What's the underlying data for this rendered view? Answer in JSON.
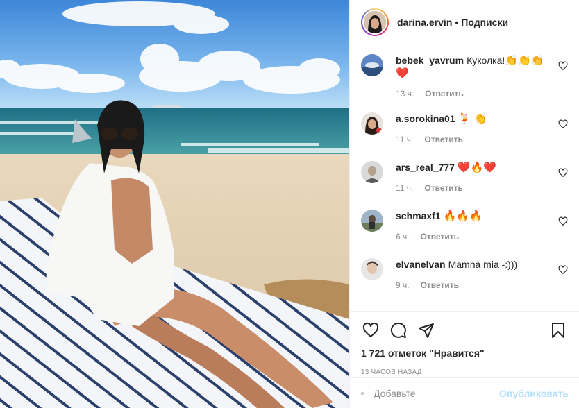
{
  "header": {
    "username": "darina.ervin",
    "separator": "•",
    "follow_label": "Подписки"
  },
  "comments": [
    {
      "user": "bebek_yavrum",
      "text": "Куколка!",
      "emoji": "👏👏👏❤️",
      "time": "13 ч.",
      "reply": "Ответить"
    },
    {
      "user": "a.sorokina01",
      "text": "",
      "emoji": "🍹 👏",
      "time": "11 ч.",
      "reply": "Ответить"
    },
    {
      "user": "ars_real_777",
      "text": "",
      "emoji": "❤️🔥❤️",
      "time": "11 ч.",
      "reply": "Ответить"
    },
    {
      "user": "schmaxf1",
      "text": "",
      "emoji": "🔥🔥🔥",
      "time": "6 ч.",
      "reply": "Ответить"
    },
    {
      "user": "elvanelvan",
      "text": "Mamna mia -:)))",
      "emoji": "",
      "time": "9 ч.",
      "reply": "Ответить"
    }
  ],
  "likes": "1 721 отметок \"Нравится\"",
  "posted": "13 часов назад",
  "add_comment": {
    "placeholder": "Добавьте",
    "publish_label": "Опубликовать"
  },
  "icons": [
    "heart-icon",
    "comment-icon",
    "share-icon",
    "bookmark-icon",
    "emoji-icon"
  ],
  "colors": {
    "publish": "#b2dffc",
    "muted": "#8e8e8e",
    "text": "#262626"
  }
}
